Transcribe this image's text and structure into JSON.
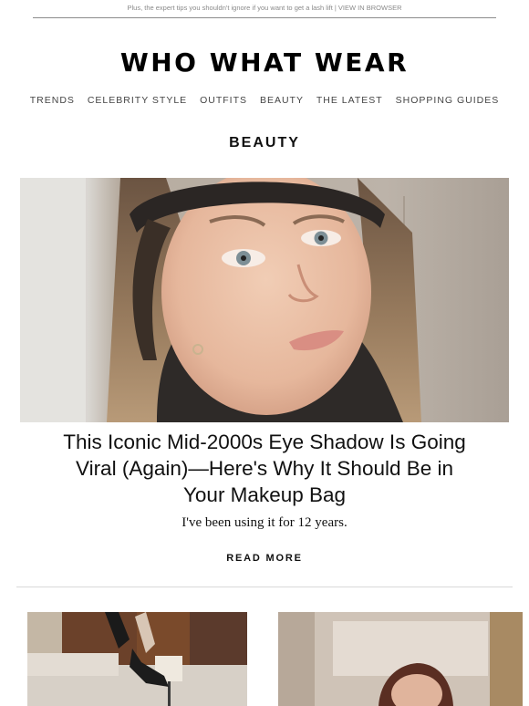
{
  "preheader": {
    "text": "Plus, the expert tips you shouldn't ignore if you want to get a lash lift |",
    "link": "VIEW IN BROWSER"
  },
  "brand": {
    "logo": "WHO WHAT WEAR"
  },
  "nav": {
    "items": [
      "TRENDS",
      "CELEBRITY STYLE",
      "OUTFITS",
      "BEAUTY",
      "THE LATEST",
      "SHOPPING GUIDES"
    ]
  },
  "section": {
    "title": "BEAUTY"
  },
  "feature": {
    "headline": "This Iconic Mid-2000s Eye Shadow Is Going Viral (Again)—Here's Why It Should Be in Your Makeup Bag",
    "dek": "I've been using it for 12 years.",
    "cta": "READ MORE"
  },
  "colors": {
    "text": "#111111",
    "muted": "#8a8a8a",
    "nav": "#444444",
    "divider": "#d9d9d9"
  }
}
